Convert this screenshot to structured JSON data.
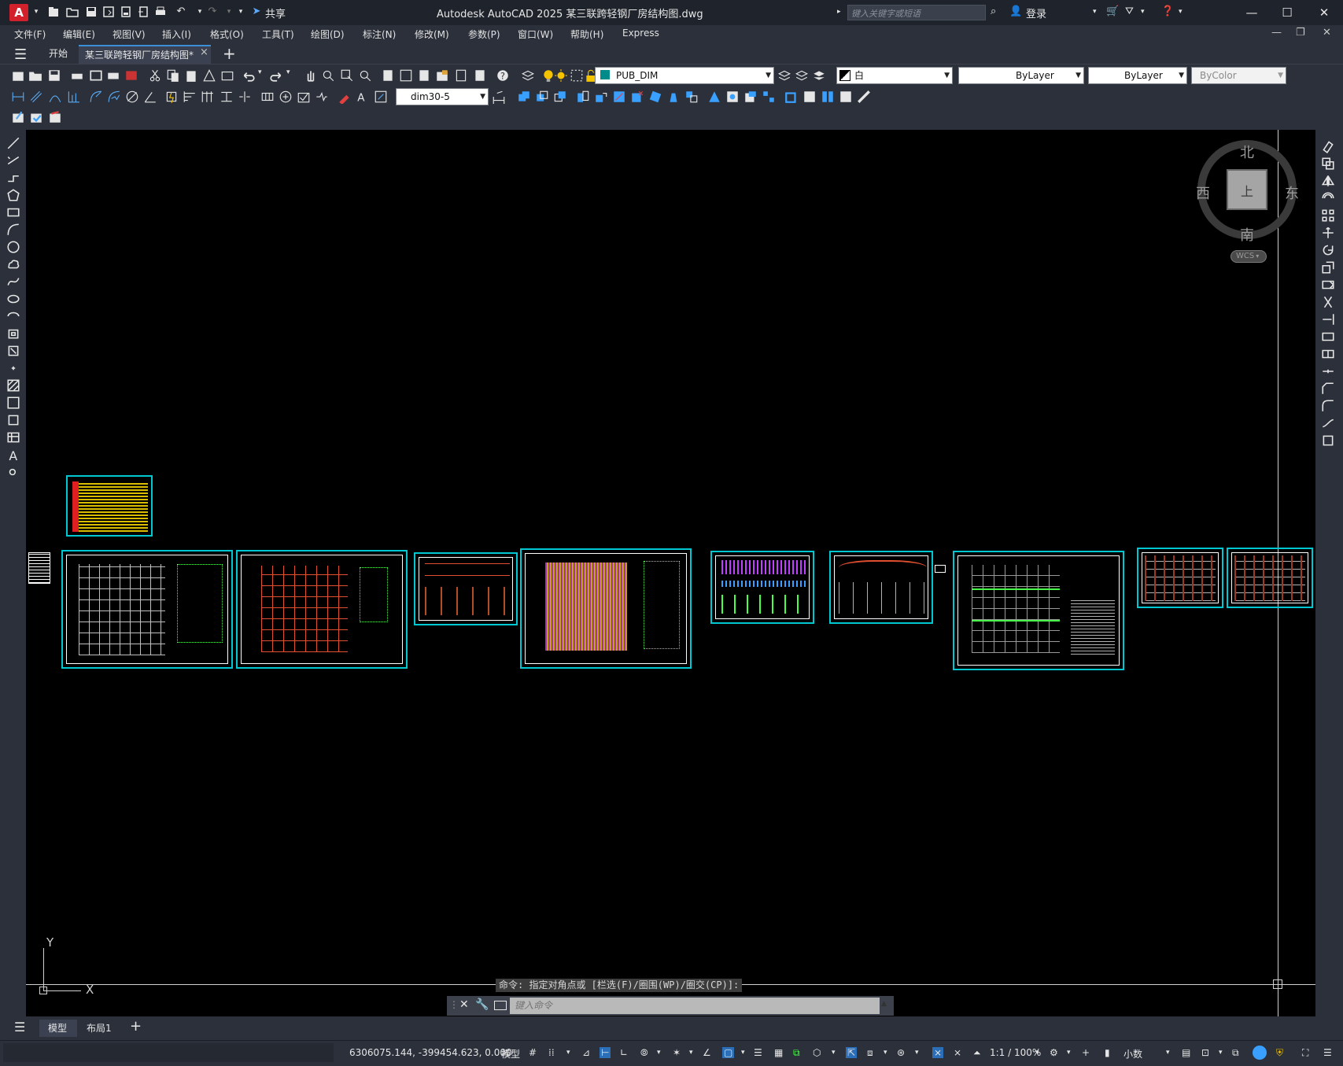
{
  "app": {
    "logo_letter": "A",
    "title": "Autodesk AutoCAD 2025    某三联跨轻钢厂房结构图.dwg",
    "search_placeholder": "键入关键字或短语",
    "login_label": "登录",
    "share_label": "共享"
  },
  "menubar": {
    "items": [
      "文件(F)",
      "编辑(E)",
      "视图(V)",
      "插入(I)",
      "格式(O)",
      "工具(T)",
      "绘图(D)",
      "标注(N)",
      "修改(M)",
      "参数(P)",
      "窗口(W)",
      "帮助(H)",
      "Express"
    ]
  },
  "doc_tabs": {
    "start_label": "开始",
    "active_label": "某三联跨轻钢厂房结构图*",
    "close_symbol": "×",
    "add_symbol": "+"
  },
  "properties": {
    "layer_name": "PUB_DIM",
    "color_value": "白",
    "linetype_value": "ByLayer",
    "lineweight_value": "ByLayer",
    "plotstyle_value": "ByColor",
    "dimstyle_value": "dim30-5"
  },
  "viewcube": {
    "north": "北",
    "south": "南",
    "east": "东",
    "west": "西",
    "face_label": "上",
    "ucs_label": "WCS"
  },
  "ucs_icon": {
    "x_label": "X",
    "y_label": "Y"
  },
  "command": {
    "history_line": "命令: 指定对角点或 [栏选(F)/圈围(WP)/圈交(CP)]:",
    "input_placeholder": "键入命令"
  },
  "layout_tabs": {
    "model_label": "模型",
    "layout1_label": "布局1",
    "add_symbol": "+"
  },
  "statusbar": {
    "coordinates": "6306075.144, -399454.623, 0.000",
    "model_label": "模型",
    "annotation_scale": "1:1 / 100%",
    "units_label": "小数"
  },
  "colors": {
    "accent": "#3b8fd6",
    "sheet_border": "#00c8d2",
    "canvas_bg": "#000000",
    "logo_red": "#d2212b"
  }
}
